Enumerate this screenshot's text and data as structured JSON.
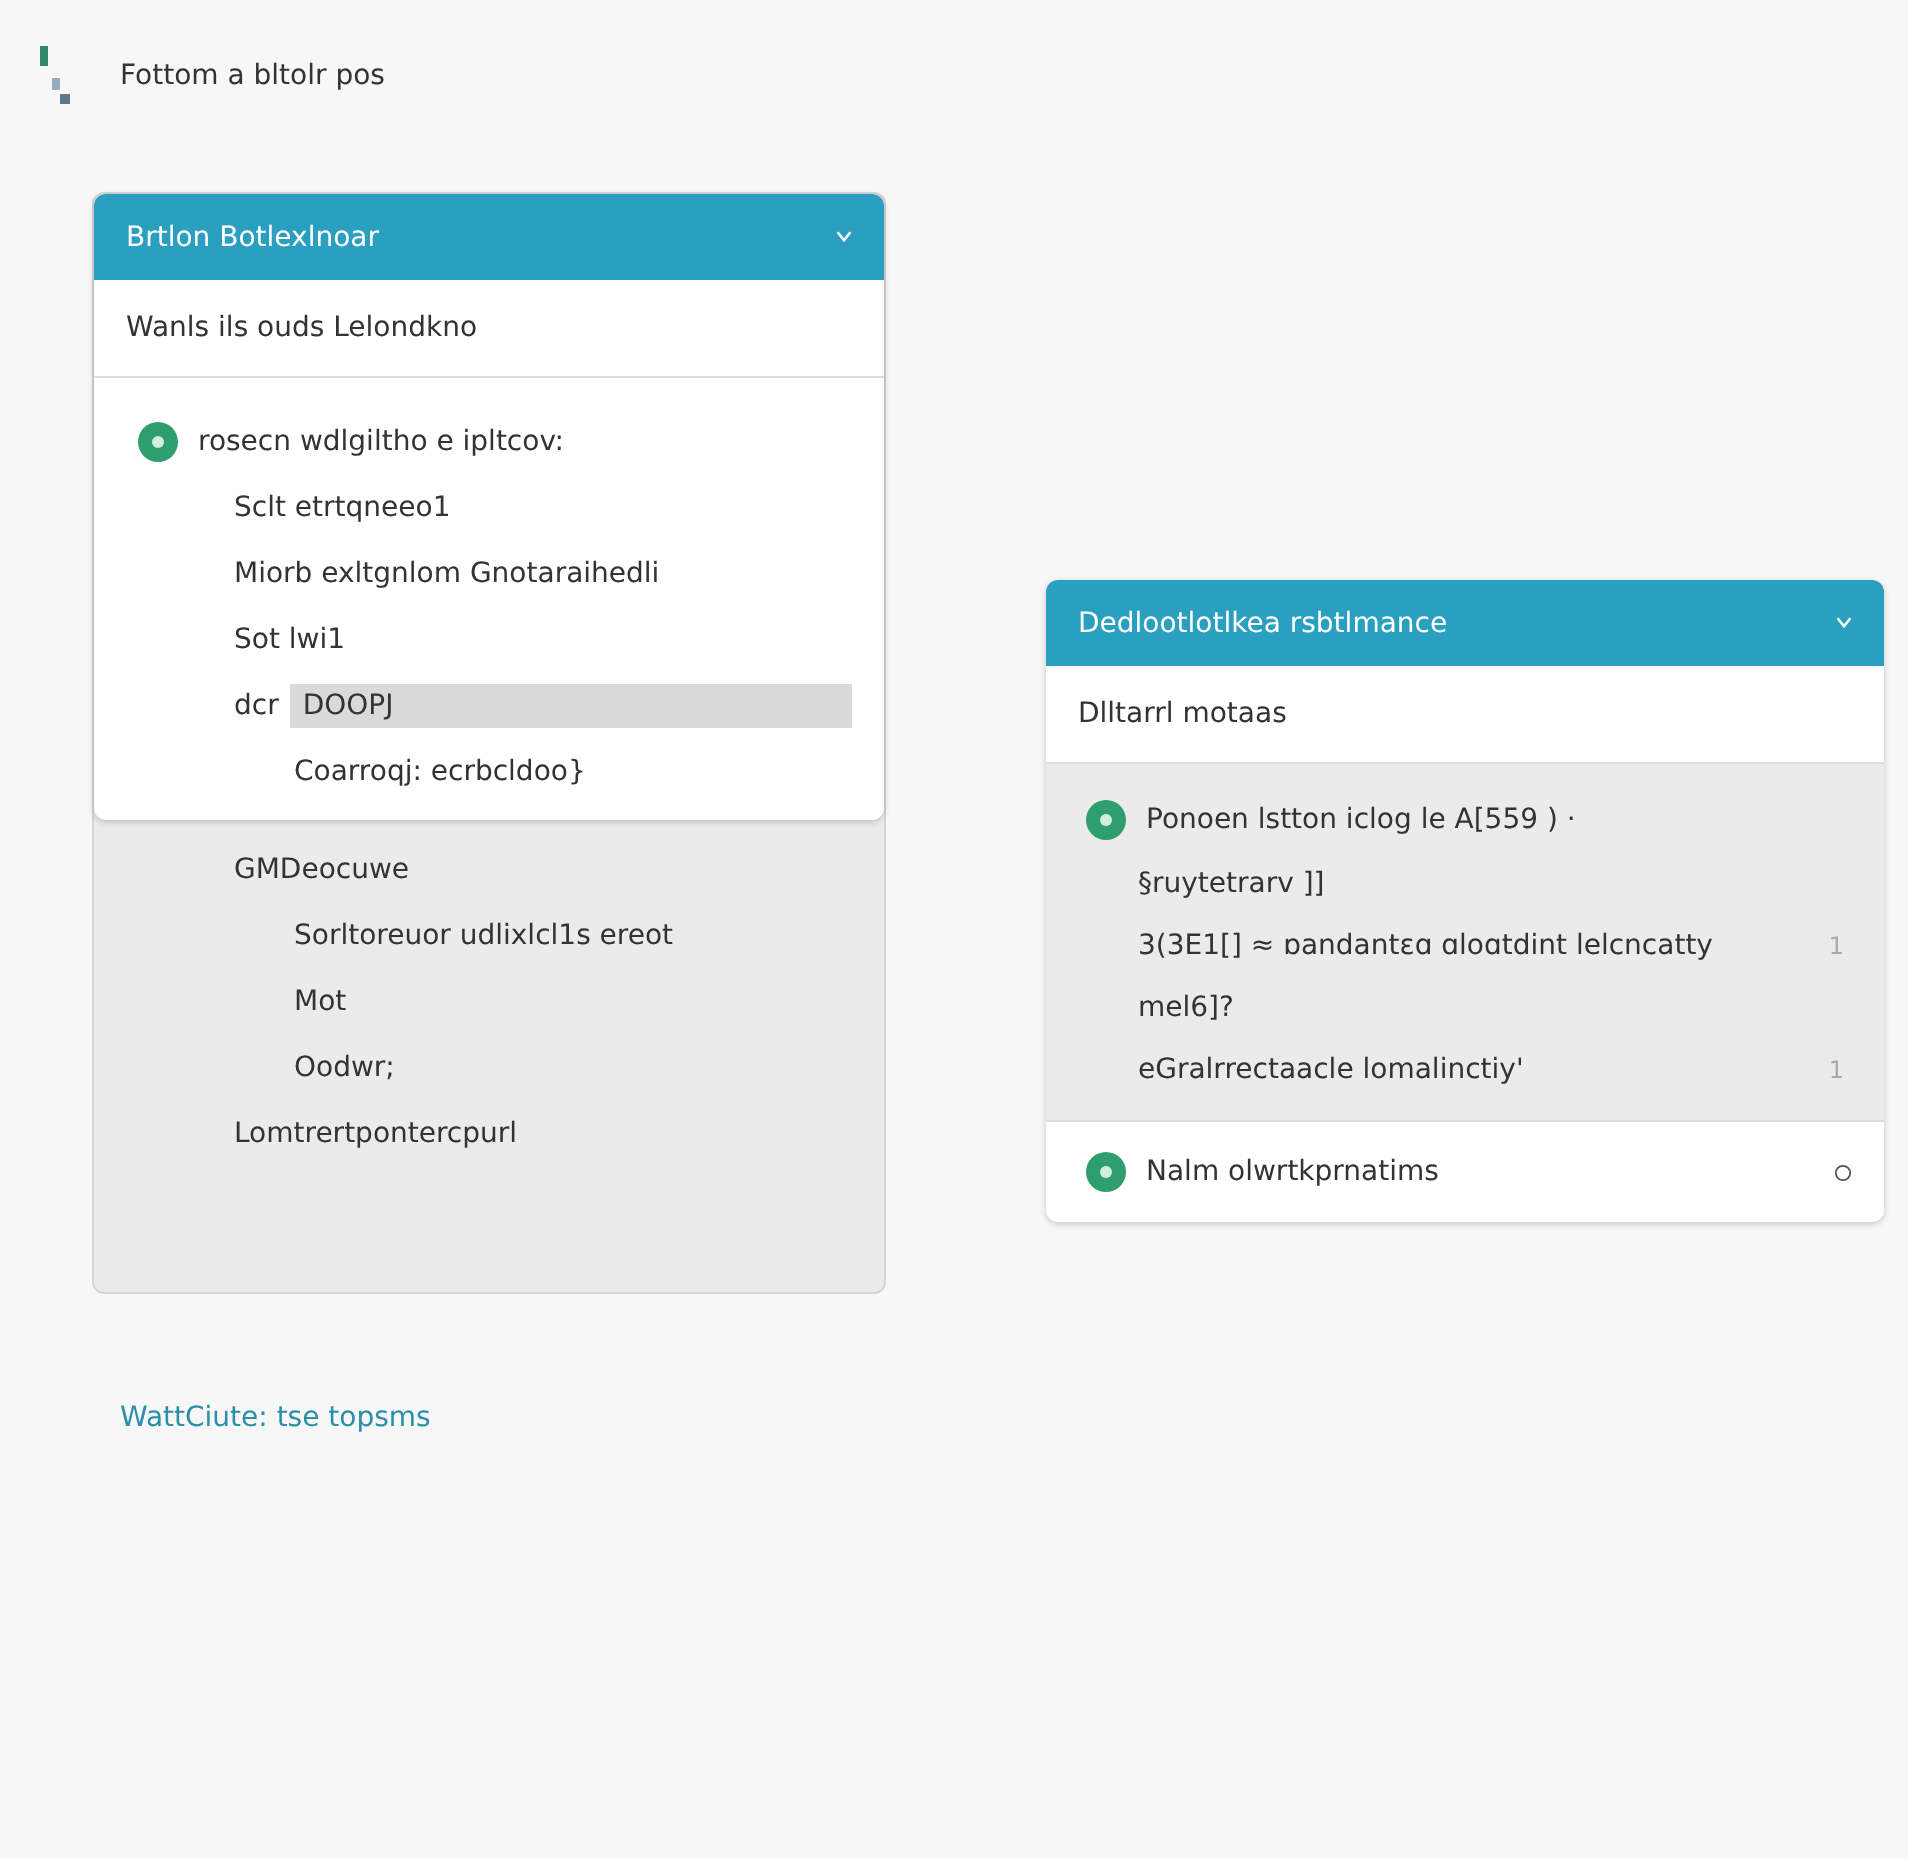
{
  "page_title": "Fottom a bltolr pos",
  "left_card": {
    "title": "Brtlon Botlexlnoar",
    "subtitle": "Wanls ils ouds Lelondkno",
    "rows": [
      {
        "text": "rosecn wdlgiltho e ipltcov:",
        "kind": "lead",
        "children": [
          {
            "text": "Sclt etrtqneeo1"
          },
          {
            "text": "Miorb exltgnlom Gnotaraihedli"
          },
          {
            "text": "Sot lwi1"
          },
          {
            "text": "dcr",
            "value": "DOOPJ",
            "selected": true,
            "children": [
              {
                "text": "Coarroqj: ecrbcldoo}"
              }
            ]
          }
        ]
      }
    ],
    "lower_rows": [
      {
        "text": "GMDeocuwe",
        "children": [
          {
            "text": "Sorltoreuor udlixlcl1s ereot"
          },
          {
            "text": "Mot"
          },
          {
            "text": "Oodwr;"
          }
        ]
      },
      {
        "text": "Lomtrertpontercpurl"
      }
    ]
  },
  "right_card": {
    "title": "Dedlootlotlkea rsbtlmance",
    "subtitle": "Dlltarrl motaas",
    "lead": "Ponoen lstton iclog le A[559 ) ·",
    "rows": [
      {
        "text": "§ruytetrarv ]]"
      },
      {
        "text": "3(3E1[] ≈ ɒandantɛɑ ɑloɑtdint lelcncatty",
        "count": "1"
      },
      {
        "text": "mel6]?"
      },
      {
        "text": "eGralrrectaacle lomalinctiy'",
        "count": "1"
      }
    ],
    "footer": "Nalm olwrtkprnatims"
  },
  "link": "WattCiute: tse topsms"
}
